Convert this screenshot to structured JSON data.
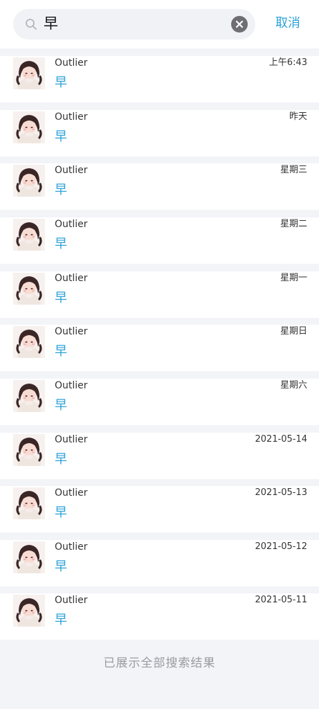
{
  "search": {
    "query": "早",
    "cancel_label": "取消"
  },
  "results": [
    {
      "name": "Outlier",
      "time": "上午6:43",
      "message": "早"
    },
    {
      "name": "Outlier",
      "time": "昨天",
      "message": "早"
    },
    {
      "name": "Outlier",
      "time": "星期三",
      "message": "早"
    },
    {
      "name": "Outlier",
      "time": "星期二",
      "message": "早"
    },
    {
      "name": "Outlier",
      "time": "星期一",
      "message": "早"
    },
    {
      "name": "Outlier",
      "time": "星期日",
      "message": "早"
    },
    {
      "name": "Outlier",
      "time": "星期六",
      "message": "早"
    },
    {
      "name": "Outlier",
      "time": "2021-05-14",
      "message": "早"
    },
    {
      "name": "Outlier",
      "time": "2021-05-13",
      "message": "早"
    },
    {
      "name": "Outlier",
      "time": "2021-05-12",
      "message": "早"
    },
    {
      "name": "Outlier",
      "time": "2021-05-11",
      "message": "早"
    }
  ],
  "footer": {
    "text": "已展示全部搜索结果"
  },
  "colors": {
    "accent": "#2ca2d8",
    "background": "#f3f4f8"
  }
}
